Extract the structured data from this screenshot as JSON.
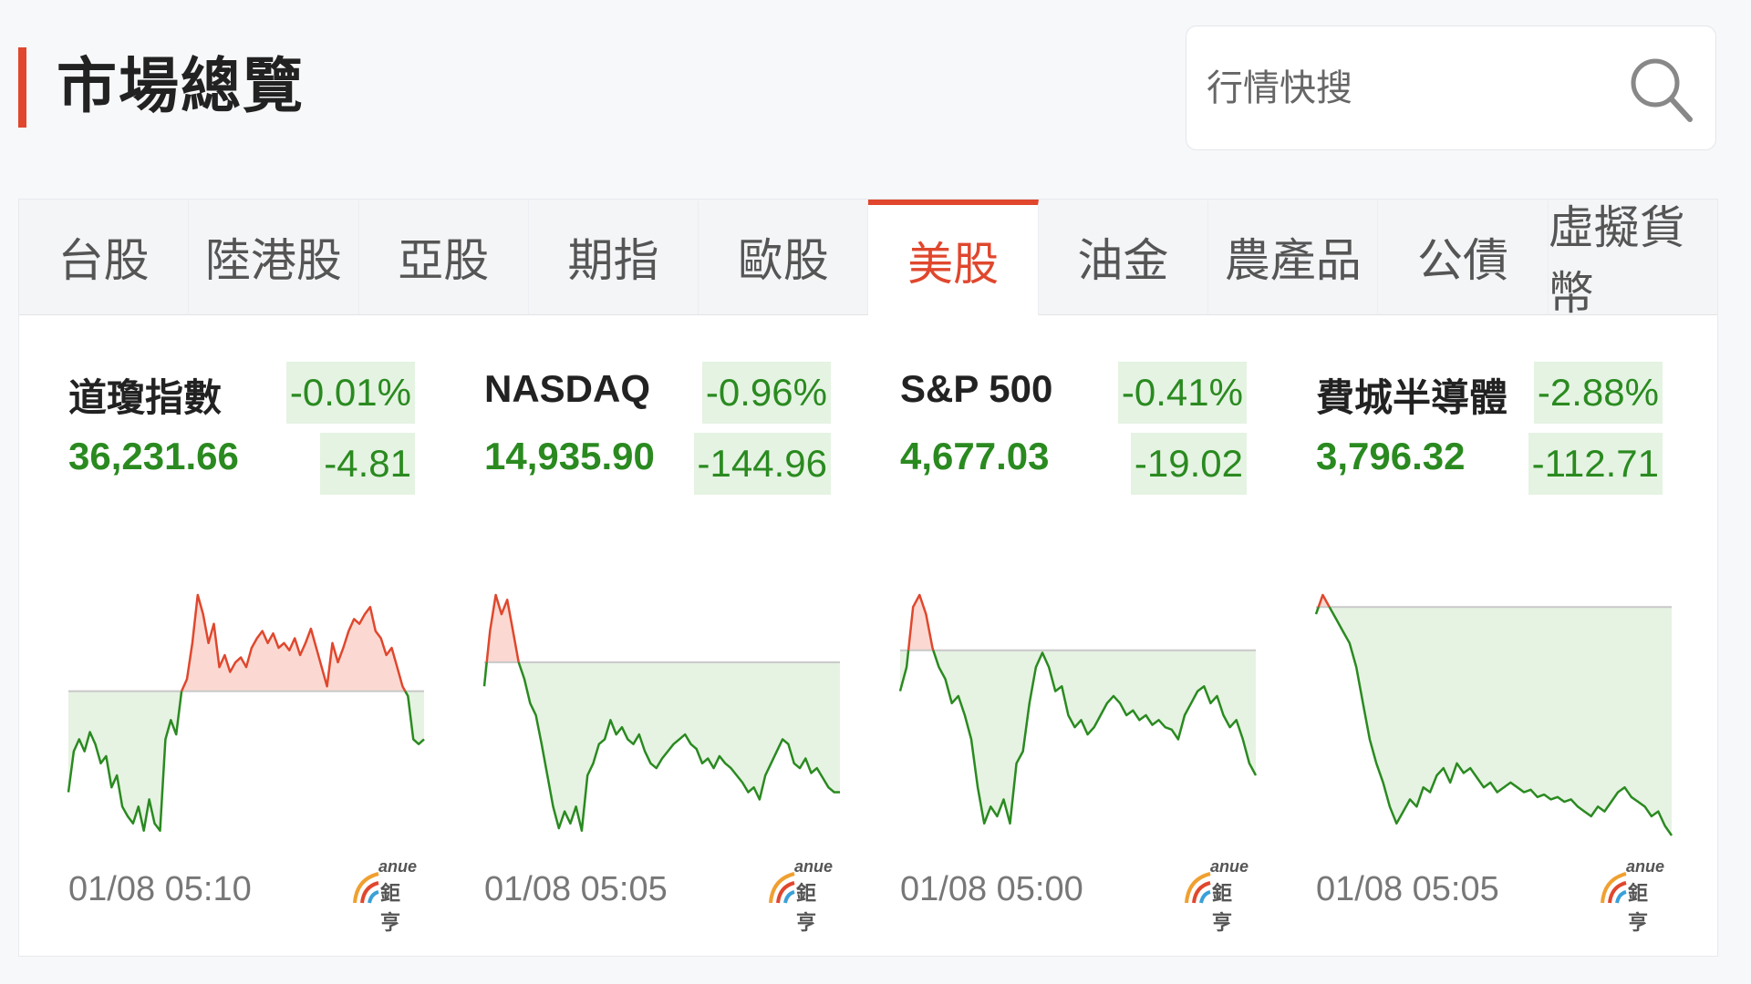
{
  "header": {
    "title": "市場總覽"
  },
  "search": {
    "placeholder": "行情快搜"
  },
  "tabs": [
    {
      "label": "台股"
    },
    {
      "label": "陸港股"
    },
    {
      "label": "亞股"
    },
    {
      "label": "期指"
    },
    {
      "label": "歐股"
    },
    {
      "label": "美股",
      "active": true
    },
    {
      "label": "油金"
    },
    {
      "label": "農產品"
    },
    {
      "label": "公債"
    },
    {
      "label": "虛擬貨幣"
    }
  ],
  "cards": [
    {
      "name": "道瓊指數",
      "price": "36,231.66",
      "change_pct": "-0.01%",
      "change": "-4.81",
      "time": "01/08 05:10"
    },
    {
      "name": "NASDAQ",
      "price": "14,935.90",
      "change_pct": "-0.96%",
      "change": "-144.96",
      "time": "01/08 05:05"
    },
    {
      "name": "S&P 500",
      "price": "4,677.03",
      "change_pct": "-0.41%",
      "change": "-19.02",
      "time": "01/08 05:00"
    },
    {
      "name": "費城半導體",
      "price": "3,796.32",
      "change_pct": "-2.88%",
      "change": "-112.71",
      "time": "01/08 05:05"
    }
  ],
  "brand": {
    "en": "anue",
    "zh": "鉅亨"
  },
  "colors": {
    "accent": "#e0472d",
    "down": "#2a8a20",
    "up": "#e0472d",
    "down_bg": "#e5f3e2",
    "up_fill": "#fbd9d2",
    "down_fill": "#e6f2e2"
  },
  "icons": {
    "search": "search-icon",
    "logo": "anue-logo-icon"
  },
  "chart_data": [
    {
      "type": "line",
      "title": "道瓊指數",
      "baseline_level": 0.6,
      "levels": [
        0.18,
        0.35,
        0.4,
        0.35,
        0.43,
        0.38,
        0.3,
        0.33,
        0.2,
        0.25,
        0.12,
        0.08,
        0.05,
        0.12,
        0.02,
        0.15,
        0.05,
        0.02,
        0.4,
        0.48,
        0.42,
        0.6,
        0.65,
        0.8,
        1.0,
        0.92,
        0.8,
        0.88,
        0.7,
        0.75,
        0.68,
        0.72,
        0.74,
        0.7,
        0.78,
        0.82,
        0.85,
        0.8,
        0.84,
        0.78,
        0.8,
        0.77,
        0.82,
        0.75,
        0.8,
        0.86,
        0.78,
        0.7,
        0.62,
        0.8,
        0.72,
        0.78,
        0.85,
        0.9,
        0.88,
        0.92,
        0.95,
        0.85,
        0.82,
        0.75,
        0.78,
        0.7,
        0.62,
        0.58,
        0.4,
        0.38,
        0.4
      ]
    },
    {
      "type": "line",
      "title": "NASDAQ",
      "baseline_level": 0.72,
      "levels": [
        0.62,
        0.85,
        1.0,
        0.92,
        0.98,
        0.85,
        0.72,
        0.65,
        0.55,
        0.5,
        0.38,
        0.25,
        0.12,
        0.03,
        0.1,
        0.05,
        0.12,
        0.02,
        0.25,
        0.3,
        0.38,
        0.4,
        0.48,
        0.42,
        0.45,
        0.4,
        0.38,
        0.42,
        0.35,
        0.3,
        0.28,
        0.32,
        0.35,
        0.38,
        0.4,
        0.42,
        0.38,
        0.36,
        0.3,
        0.32,
        0.28,
        0.33,
        0.3,
        0.28,
        0.25,
        0.22,
        0.18,
        0.2,
        0.15,
        0.25,
        0.3,
        0.35,
        0.4,
        0.38,
        0.3,
        0.28,
        0.32,
        0.26,
        0.28,
        0.24,
        0.2,
        0.18,
        0.18
      ]
    },
    {
      "type": "line",
      "title": "S&P 500",
      "baseline_level": 0.77,
      "levels": [
        0.6,
        0.7,
        0.95,
        1.0,
        0.92,
        0.78,
        0.7,
        0.65,
        0.55,
        0.58,
        0.5,
        0.4,
        0.2,
        0.05,
        0.12,
        0.08,
        0.15,
        0.05,
        0.3,
        0.35,
        0.55,
        0.7,
        0.76,
        0.7,
        0.6,
        0.62,
        0.5,
        0.45,
        0.48,
        0.42,
        0.45,
        0.5,
        0.55,
        0.58,
        0.55,
        0.5,
        0.52,
        0.48,
        0.5,
        0.46,
        0.48,
        0.45,
        0.44,
        0.4,
        0.5,
        0.55,
        0.6,
        0.62,
        0.55,
        0.58,
        0.5,
        0.45,
        0.48,
        0.4,
        0.3,
        0.25
      ]
    },
    {
      "type": "line",
      "title": "費城半導體",
      "baseline_level": 0.95,
      "levels": [
        0.92,
        1.0,
        0.95,
        0.9,
        0.85,
        0.8,
        0.7,
        0.55,
        0.4,
        0.3,
        0.22,
        0.12,
        0.05,
        0.1,
        0.15,
        0.12,
        0.2,
        0.18,
        0.25,
        0.28,
        0.22,
        0.3,
        0.26,
        0.28,
        0.24,
        0.2,
        0.22,
        0.18,
        0.2,
        0.22,
        0.2,
        0.18,
        0.19,
        0.16,
        0.17,
        0.15,
        0.16,
        0.14,
        0.15,
        0.12,
        0.1,
        0.08,
        0.12,
        0.1,
        0.14,
        0.18,
        0.2,
        0.16,
        0.14,
        0.12,
        0.08,
        0.1,
        0.04,
        0.0
      ]
    }
  ]
}
